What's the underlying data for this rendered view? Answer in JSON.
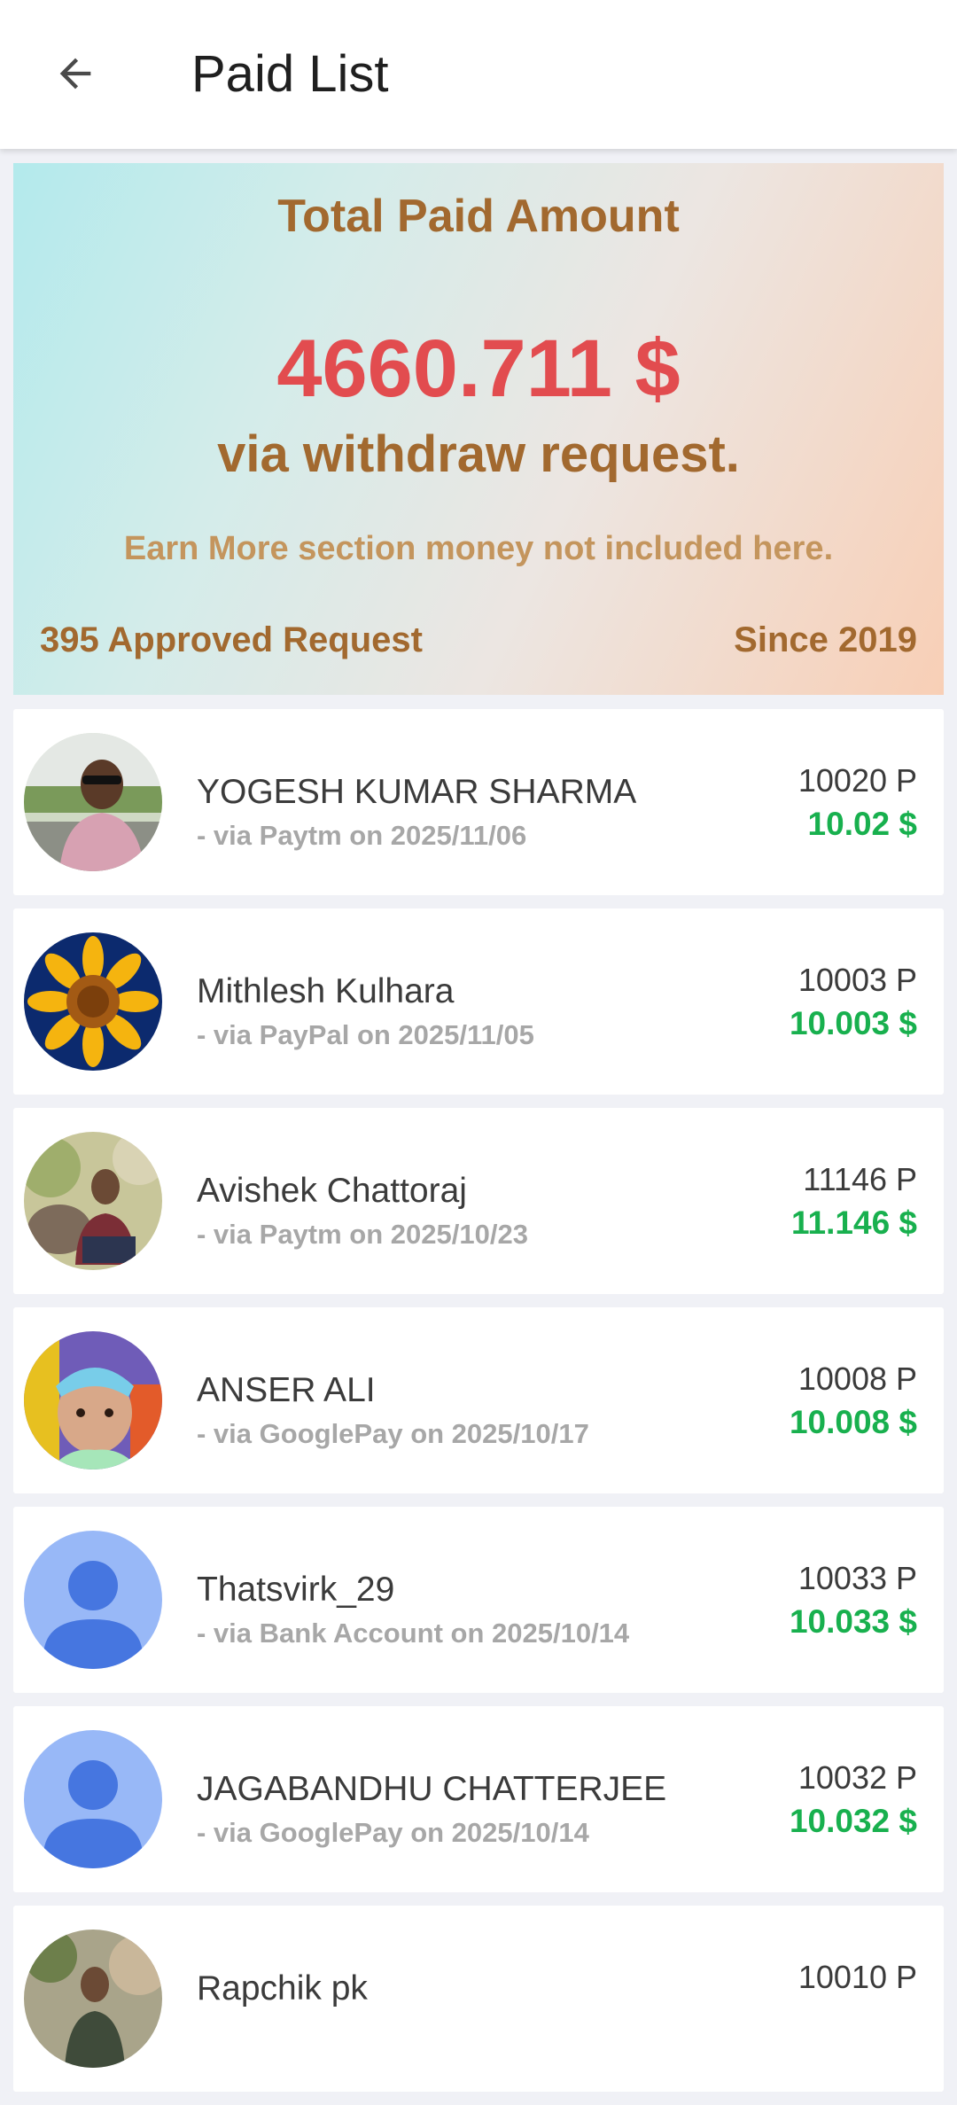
{
  "header": {
    "title": "Paid List",
    "back_icon": "arrow-back-icon"
  },
  "summary": {
    "title": "Total Paid Amount",
    "amount": "4660.711 $",
    "via_text": "via withdraw request.",
    "note": "Earn More section money not included here.",
    "approved": "395 Approved Request",
    "since": "Since 2019",
    "colors": {
      "title": "#a2692f",
      "amount": "#e24c4f",
      "gradient_start": "#b3eaec",
      "gradient_end": "#f8cfb6"
    }
  },
  "payments": [
    {
      "name": "YOGESH KUMAR SHARMA",
      "via": "- via Paytm on 2025/11/06",
      "points": "10020 P",
      "dollars": "10.02 $",
      "avatar": "photo-man-sunglasses"
    },
    {
      "name": "Mithlesh Kulhara",
      "via": "- via PayPal on 2025/11/05",
      "points": "10003 P",
      "dollars": "10.003 $",
      "avatar": "photo-sunflower"
    },
    {
      "name": "Avishek Chattoraj",
      "via": "- via Paytm on 2025/10/23",
      "points": "11146 P",
      "dollars": "11.146 $",
      "avatar": "photo-man-outdoor"
    },
    {
      "name": "ANSER ALI",
      "via": "- via GooglePay on 2025/10/17",
      "points": "10008 P",
      "dollars": "10.008 $",
      "avatar": "photo-child"
    },
    {
      "name": "Thatsvirk_29",
      "via": "- via Bank Account on 2025/10/14",
      "points": "10033 P",
      "dollars": "10.033 $",
      "avatar": "default-person-icon"
    },
    {
      "name": "JAGABANDHU CHATTERJEE",
      "via": "- via GooglePay on 2025/10/14",
      "points": "10032 P",
      "dollars": "10.032 $",
      "avatar": "default-person-icon"
    },
    {
      "name": "Rapchik pk",
      "via": "",
      "points": "10010 P",
      "dollars": "",
      "avatar": "photo-man-outdoor-2"
    }
  ],
  "colors": {
    "dollars": "#18b04e",
    "sub_text": "#a7a7a7",
    "default_avatar_bg": "#98b8f7",
    "default_avatar_fg": "#4676e0"
  }
}
